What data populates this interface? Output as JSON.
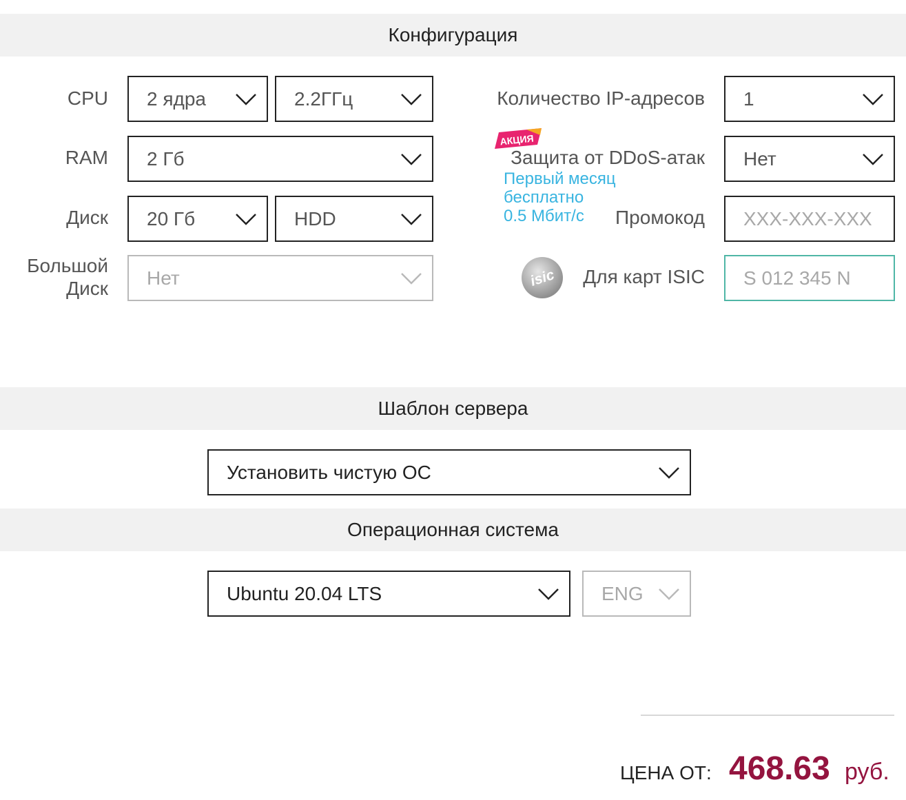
{
  "sections": {
    "configuration": "Конфигурация",
    "server_template": "Шаблон сервера",
    "os": "Операционная система"
  },
  "config": {
    "cpu": {
      "label": "CPU",
      "cores": "2 ядра",
      "frequency": "2.2ГГц"
    },
    "ram": {
      "label": "RAM",
      "value": "2 Гб"
    },
    "disk": {
      "label": "Диск",
      "size": "20 Гб",
      "type": "HDD"
    },
    "big_disk": {
      "label_line1": "Большой",
      "label_line2": "Диск",
      "value": "Нет"
    },
    "ip": {
      "label": "Количество IP-адресов",
      "value": "1"
    },
    "ddos": {
      "badge": "АКЦИЯ",
      "label": "Защита от DDoS-атак",
      "value": "Нет",
      "promo_line1": "Первый месяц",
      "promo_line2": "бесплатно",
      "promo_line3": "0.5 Мбит/с"
    },
    "promo": {
      "label": "Промокод",
      "placeholder": "XXX-XXX-XXX"
    },
    "isic": {
      "icon_text": "isic",
      "label": "Для карт ISIC",
      "placeholder": "S 012 345 N"
    }
  },
  "template": {
    "value": "Установить чистую ОС"
  },
  "os": {
    "value": "Ubuntu 20.04 LTS",
    "language": "ENG"
  },
  "price": {
    "label": "ЦЕНА ОТ:",
    "value": "468.63",
    "currency": "руб."
  },
  "colors": {
    "accent": "#94143f",
    "promo": "#38b4e0",
    "badge": "#e8246f",
    "isic_border": "#4fb6a6",
    "band": "#f1f1f1"
  },
  "icons": {
    "dropdown": "chevron-down-icon",
    "isic": "isic-logo-icon",
    "badge": "promo-badge-icon"
  }
}
